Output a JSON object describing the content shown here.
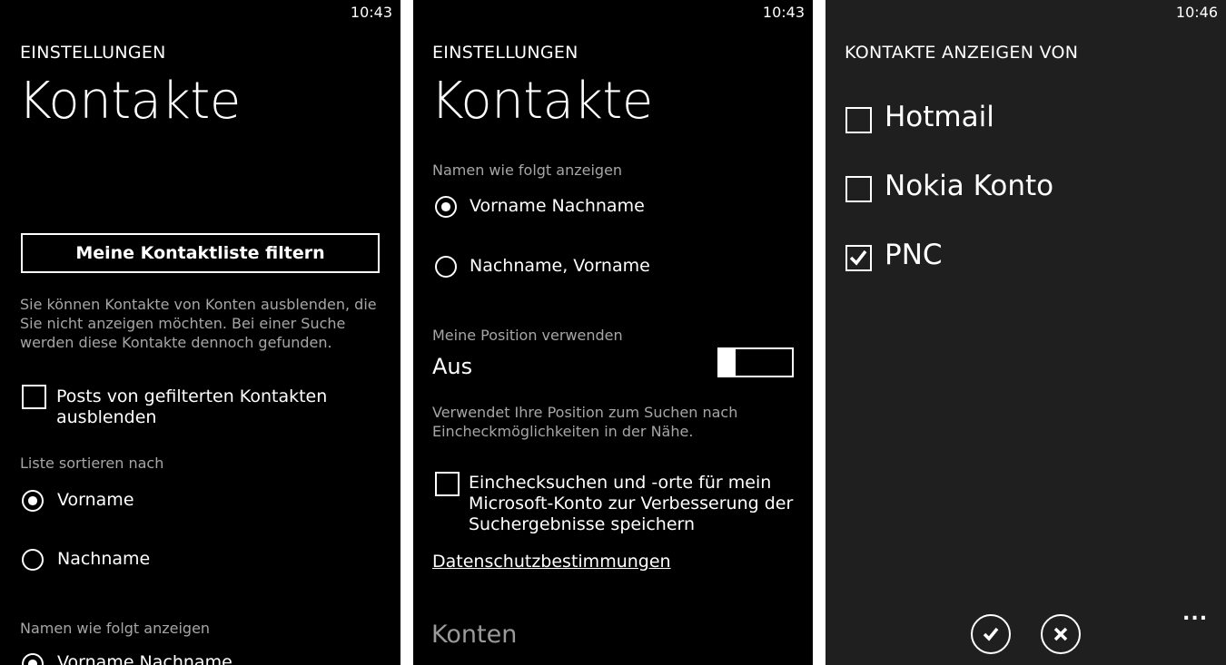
{
  "screen1": {
    "time": "10:43",
    "section": "EINSTELLUNGEN",
    "title": "Kontakte",
    "filter_button": "Meine Kontaktliste filtern",
    "filter_desc": "Sie können Kontakte von Konten ausblenden, die Sie nicht anzeigen möchten. Bei einer Suche werden diese Kontakte dennoch gefunden.",
    "hide_posts": {
      "label": "Posts von gefilterten Kontakten ausblenden",
      "checked": false
    },
    "sort_label": "Liste sortieren nach",
    "sort_options": [
      {
        "label": "Vorname",
        "selected": true
      },
      {
        "label": "Nachname",
        "selected": false
      }
    ],
    "names_label": "Namen wie folgt anzeigen",
    "names_first_option": "Vorname Nachname"
  },
  "screen2": {
    "time": "10:43",
    "section": "EINSTELLUNGEN",
    "title": "Kontakte",
    "names_label": "Namen wie folgt anzeigen",
    "name_options": [
      {
        "label": "Vorname Nachname",
        "selected": true
      },
      {
        "label": "Nachname, Vorname",
        "selected": false
      }
    ],
    "position_label": "Meine Position verwenden",
    "position_state": "Aus",
    "position_on": false,
    "position_desc": "Verwendet Ihre Position zum Suchen nach Eincheckmöglichkeiten in der Nähe.",
    "checkin_save": {
      "label": "Einchecksuchen und -orte für mein Microsoft-Konto zur Verbesserung der Suchergebnisse speichern",
      "checked": false
    },
    "privacy_link": "Datenschutzbestimmungen",
    "accounts_heading": "Konten"
  },
  "screen3": {
    "time": "10:46",
    "header": "KONTAKTE ANZEIGEN VON",
    "accounts": [
      {
        "label": "Hotmail",
        "checked": false
      },
      {
        "label": "Nokia Konto",
        "checked": false
      },
      {
        "label": "PNC",
        "checked": true
      }
    ],
    "appbar": {
      "confirm_icon": "checkmark-icon",
      "cancel_icon": "close-icon",
      "more": "..."
    }
  }
}
